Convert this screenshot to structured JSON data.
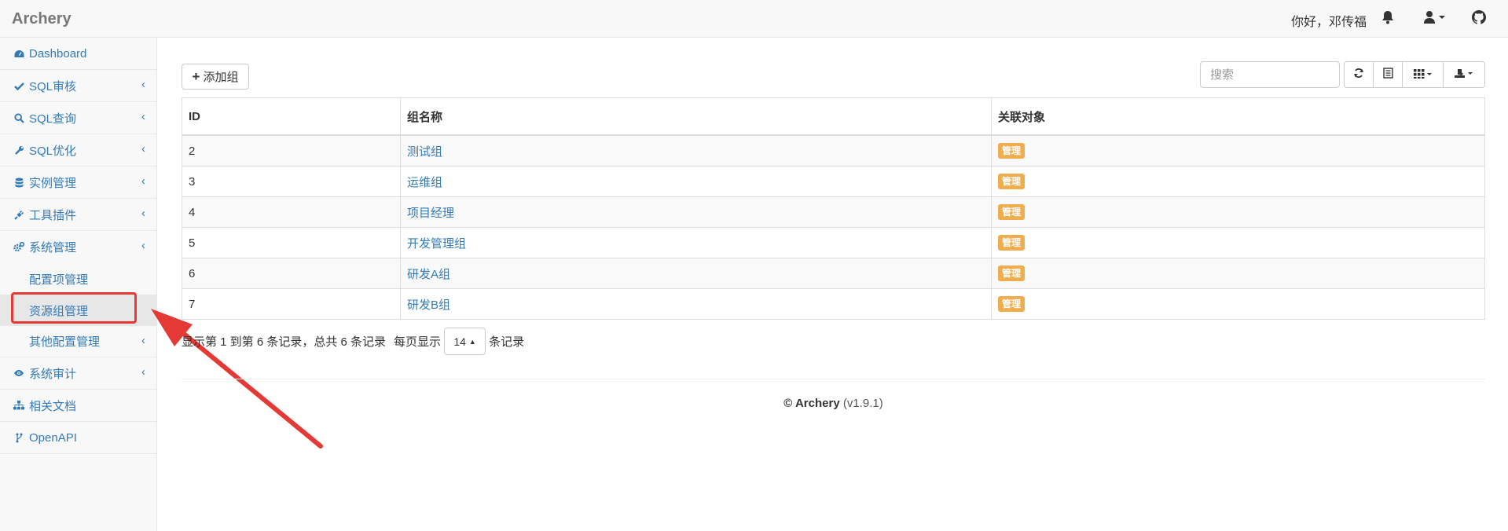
{
  "app": {
    "brand": "Archery",
    "greeting": "你好，邓传福"
  },
  "nav_icons": [
    "bell-icon",
    "user-icon",
    "github-icon"
  ],
  "sidebar": {
    "items": [
      {
        "label": "Dashboard",
        "icon": "dashboard-icon",
        "chevron": false
      },
      {
        "label": "SQL审核",
        "icon": "check-icon",
        "chevron": true
      },
      {
        "label": "SQL查询",
        "icon": "search-icon",
        "chevron": true
      },
      {
        "label": "SQL优化",
        "icon": "wrench-icon",
        "chevron": true
      },
      {
        "label": "实例管理",
        "icon": "database-icon",
        "chevron": true
      },
      {
        "label": "工具插件",
        "icon": "plug-icon",
        "chevron": true
      },
      {
        "label": "系统管理",
        "icon": "cogs-icon",
        "chevron": true
      }
    ],
    "subitems": [
      {
        "label": "配置项管理"
      },
      {
        "label": "资源组管理",
        "active": true
      },
      {
        "label": "其他配置管理",
        "chevron": true
      }
    ],
    "items_after": [
      {
        "label": "系统审计",
        "icon": "eye-icon",
        "chevron": true
      },
      {
        "label": "相关文档",
        "icon": "sitemap-icon",
        "chevron": false
      },
      {
        "label": "OpenAPI",
        "icon": "code-fork-icon",
        "chevron": false
      }
    ]
  },
  "toolbar": {
    "add_label": "添加组",
    "search_placeholder": "搜索",
    "pagesize": "14"
  },
  "table": {
    "columns": [
      "ID",
      "组名称",
      "关联对象"
    ],
    "rows": [
      {
        "id": "2",
        "name": "测试组",
        "action": "管理"
      },
      {
        "id": "3",
        "name": "运维组",
        "action": "管理"
      },
      {
        "id": "4",
        "name": "项目经理",
        "action": "管理"
      },
      {
        "id": "5",
        "name": "开发管理组",
        "action": "管理"
      },
      {
        "id": "6",
        "name": "研发A组",
        "action": "管理"
      },
      {
        "id": "7",
        "name": "研发B组",
        "action": "管理"
      }
    ]
  },
  "pagination": {
    "summary": "显示第 1 到第 6 条记录，总共 6 条记录",
    "per_page": "每页显示",
    "records": "条记录"
  },
  "footer": {
    "copyright": "© Archery",
    "version": "(v1.9.1)"
  },
  "colors": {
    "link": "#337ab7",
    "badge": "#f0ad4e",
    "annotation": "#e53935"
  }
}
